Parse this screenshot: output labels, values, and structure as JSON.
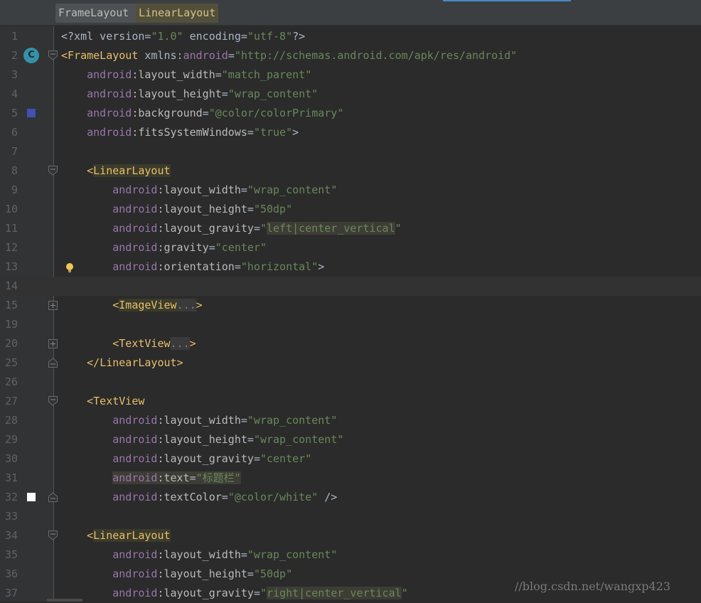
{
  "breadcrumbs": [
    "FrameLayout",
    "LinearLayout"
  ],
  "lines": [
    {
      "num": "1",
      "segs": [
        [
          "p",
          "<?xml version="
        ],
        [
          "s",
          "\"1.0\""
        ],
        [
          "p",
          " encoding="
        ],
        [
          "s",
          "\"utf-8\""
        ],
        [
          "p",
          "?>"
        ]
      ]
    },
    {
      "num": "2",
      "gicon": "c",
      "fold": "top",
      "segs": [
        [
          "tb",
          "<"
        ],
        [
          "t",
          "FrameLayout"
        ],
        [
          "p",
          " xmlns:"
        ],
        [
          "n",
          "android"
        ],
        [
          "p",
          "="
        ],
        [
          "s",
          "\"http://schemas.android.com/apk/res/android\""
        ]
      ]
    },
    {
      "num": "3",
      "segs": [
        [
          "i",
          "    "
        ],
        [
          "n",
          "android"
        ],
        [
          "a",
          ":layout_width"
        ],
        [
          "p",
          "="
        ],
        [
          "s",
          "\"match_parent\""
        ]
      ]
    },
    {
      "num": "4",
      "segs": [
        [
          "i",
          "    "
        ],
        [
          "n",
          "android"
        ],
        [
          "a",
          ":layout_height"
        ],
        [
          "p",
          "="
        ],
        [
          "s",
          "\"wrap_content\""
        ]
      ]
    },
    {
      "num": "5",
      "gicon": "blue",
      "segs": [
        [
          "i",
          "    "
        ],
        [
          "n",
          "android"
        ],
        [
          "a",
          ":background"
        ],
        [
          "p",
          "="
        ],
        [
          "s",
          "\"@color/colorPrimary\""
        ]
      ]
    },
    {
      "num": "6",
      "segs": [
        [
          "i",
          "    "
        ],
        [
          "n",
          "android"
        ],
        [
          "a",
          ":fitsSystemWindows"
        ],
        [
          "p",
          "="
        ],
        [
          "s",
          "\"true\""
        ],
        [
          "p",
          ">"
        ]
      ]
    },
    {
      "num": "7",
      "segs": []
    },
    {
      "num": "8",
      "fold": "top",
      "segs": [
        [
          "i",
          "    "
        ],
        [
          "tb",
          "<"
        ],
        [
          "th",
          "LinearLayout"
        ]
      ]
    },
    {
      "num": "9",
      "segs": [
        [
          "i",
          "        "
        ],
        [
          "n",
          "android"
        ],
        [
          "a",
          ":layout_width"
        ],
        [
          "p",
          "="
        ],
        [
          "s",
          "\"wrap_content\""
        ]
      ]
    },
    {
      "num": "10",
      "segs": [
        [
          "i",
          "        "
        ],
        [
          "n",
          "android"
        ],
        [
          "a",
          ":layout_height"
        ],
        [
          "p",
          "="
        ],
        [
          "s",
          "\"50dp\""
        ]
      ]
    },
    {
      "num": "11",
      "segs": [
        [
          "i",
          "        "
        ],
        [
          "n",
          "android"
        ],
        [
          "a",
          ":layout_gravity"
        ],
        [
          "p",
          "="
        ],
        [
          "s",
          "\""
        ],
        [
          "sh",
          "left|center_vertical"
        ],
        [
          "s",
          "\""
        ]
      ]
    },
    {
      "num": "12",
      "segs": [
        [
          "i",
          "        "
        ],
        [
          "n",
          "android"
        ],
        [
          "a",
          ":gravity"
        ],
        [
          "p",
          "="
        ],
        [
          "s",
          "\"center\""
        ]
      ]
    },
    {
      "num": "13",
      "gicon": "bulb",
      "segs": [
        [
          "i",
          "        "
        ],
        [
          "n",
          "android"
        ],
        [
          "a",
          ":orientation"
        ],
        [
          "p",
          "="
        ],
        [
          "s",
          "\"horizontal\""
        ],
        [
          "p",
          ">"
        ]
      ]
    },
    {
      "num": "14",
      "current": true,
      "segs": []
    },
    {
      "num": "15",
      "fold": "plus",
      "segs": [
        [
          "i",
          "        "
        ],
        [
          "tb",
          "<"
        ],
        [
          "th",
          "ImageView"
        ],
        [
          "f",
          "..."
        ],
        [
          "tb",
          ">"
        ]
      ]
    },
    {
      "num": "19",
      "segs": []
    },
    {
      "num": "20",
      "fold": "plus",
      "segs": [
        [
          "i",
          "        "
        ],
        [
          "tb",
          "<"
        ],
        [
          "t",
          "TextView"
        ],
        [
          "f",
          "..."
        ],
        [
          "tb",
          ">"
        ]
      ]
    },
    {
      "num": "25",
      "fold": "end",
      "segs": [
        [
          "i",
          "    "
        ],
        [
          "tb",
          "</"
        ],
        [
          "t",
          "LinearLayout"
        ],
        [
          "tb",
          ">"
        ]
      ]
    },
    {
      "num": "26",
      "segs": []
    },
    {
      "num": "27",
      "fold": "top",
      "segs": [
        [
          "i",
          "    "
        ],
        [
          "tb",
          "<"
        ],
        [
          "t",
          "TextView"
        ]
      ]
    },
    {
      "num": "28",
      "segs": [
        [
          "i",
          "        "
        ],
        [
          "n",
          "android"
        ],
        [
          "a",
          ":layout_width"
        ],
        [
          "p",
          "="
        ],
        [
          "s",
          "\"wrap_content\""
        ]
      ]
    },
    {
      "num": "29",
      "segs": [
        [
          "i",
          "        "
        ],
        [
          "n",
          "android"
        ],
        [
          "a",
          ":layout_height"
        ],
        [
          "p",
          "="
        ],
        [
          "s",
          "\"wrap_content\""
        ]
      ]
    },
    {
      "num": "30",
      "segs": [
        [
          "i",
          "        "
        ],
        [
          "n",
          "android"
        ],
        [
          "a",
          ":layout_gravity"
        ],
        [
          "p",
          "="
        ],
        [
          "s",
          "\"center\""
        ]
      ]
    },
    {
      "num": "31",
      "segs": [
        [
          "i",
          "        "
        ],
        [
          "nh",
          "android"
        ],
        [
          "ah",
          ":text"
        ],
        [
          "ph",
          "="
        ],
        [
          "sh",
          "\"标题栏\""
        ]
      ]
    },
    {
      "num": "32",
      "gicon": "white",
      "fold": "end",
      "segs": [
        [
          "i",
          "        "
        ],
        [
          "n",
          "android"
        ],
        [
          "a",
          ":textColor"
        ],
        [
          "p",
          "="
        ],
        [
          "s",
          "\"@color/white\""
        ],
        [
          "p",
          " />"
        ]
      ]
    },
    {
      "num": "33",
      "segs": []
    },
    {
      "num": "34",
      "fold": "top",
      "segs": [
        [
          "i",
          "    "
        ],
        [
          "tb",
          "<"
        ],
        [
          "th",
          "LinearLayout"
        ]
      ]
    },
    {
      "num": "35",
      "segs": [
        [
          "i",
          "        "
        ],
        [
          "n",
          "android"
        ],
        [
          "a",
          ":layout_width"
        ],
        [
          "p",
          "="
        ],
        [
          "s",
          "\"wrap_content\""
        ]
      ]
    },
    {
      "num": "36",
      "segs": [
        [
          "i",
          "        "
        ],
        [
          "n",
          "android"
        ],
        [
          "a",
          ":layout_height"
        ],
        [
          "p",
          "="
        ],
        [
          "s",
          "\"50dp\""
        ]
      ]
    },
    {
      "num": "37",
      "segs": [
        [
          "i",
          "        "
        ],
        [
          "n",
          "android"
        ],
        [
          "a",
          ":layout_gravity"
        ],
        [
          "p",
          "="
        ],
        [
          "s",
          "\""
        ],
        [
          "sh",
          "right|center_vertical"
        ],
        [
          "s",
          "\""
        ]
      ]
    }
  ],
  "watermark": "//blog.csdn.net/wangxp423",
  "colors": {
    "accent": "#4a88c7",
    "tag": "#e8bf6a",
    "namespace": "#9876aa",
    "string": "#6a8759",
    "background": "#2b2b2b",
    "gutter": "#313335"
  }
}
